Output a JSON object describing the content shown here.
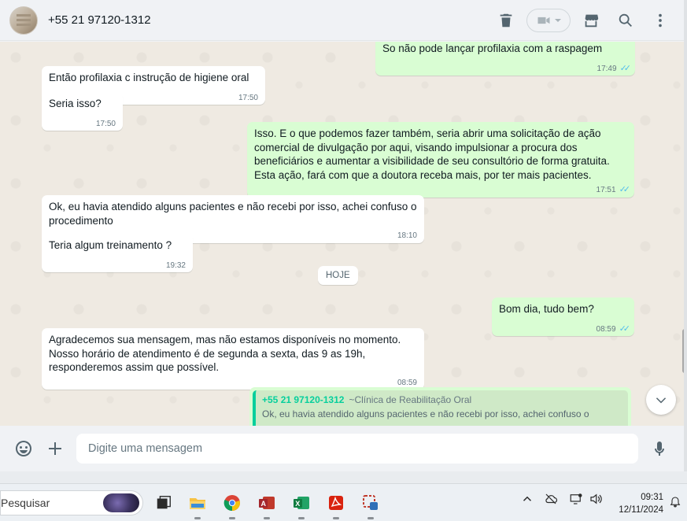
{
  "header": {
    "contact_name": "+55 21 97120-1312",
    "icons": [
      "delete-icon",
      "video-call-icon",
      "store-icon",
      "search-icon",
      "menu-icon"
    ]
  },
  "messages": [
    {
      "dir": "out",
      "text": "So não pode lançar profilaxia com a raspagem",
      "time": "17:49",
      "read": true
    },
    {
      "dir": "in",
      "text": "Então profilaxia c instrução de higiene oral",
      "time": "17:50"
    },
    {
      "dir": "in",
      "text": "Seria isso?",
      "time": "17:50"
    },
    {
      "dir": "out",
      "text": "Isso. E o que podemos fazer também, seria abrir uma solicitação de ação comercial de divulgação por aqui, visando impulsionar a procura dos beneficiários e aumentar a visibilidade de seu consultório de forma gratuita. Esta ação, fará com que a doutora receba mais, por ter mais pacientes.",
      "time": "17:51",
      "read": true
    },
    {
      "dir": "in",
      "text": "Ok, eu havia atendido alguns pacientes e não recebi por isso, achei confuso o procedimento",
      "time": "18:10"
    },
    {
      "dir": "in",
      "text": "Teria algum treinamento ?",
      "time": "19:32"
    },
    {
      "dir": "out",
      "text": "Bom dia, tudo bem?",
      "time": "08:59",
      "read": true
    },
    {
      "dir": "in",
      "text": "Agradecemos sua mensagem, mas não estamos disponíveis no momento. Nosso horário de atendimento é de segunda a sexta, das 9 as 19h, responderemos assim que possível.",
      "time": "08:59"
    }
  ],
  "date_divider": "HOJE",
  "quote": {
    "sender": "+55 21 97120-1312",
    "sender_name": "~Clínica de Reabilitação Oral",
    "text": "Ok, eu havia atendido alguns pacientes e não recebi por isso, achei confuso o"
  },
  "composer": {
    "placeholder": "Digite uma mensagem"
  },
  "taskbar": {
    "search_placeholder": "Pesquisar",
    "time": "09:31",
    "date": "12/11/2024"
  }
}
